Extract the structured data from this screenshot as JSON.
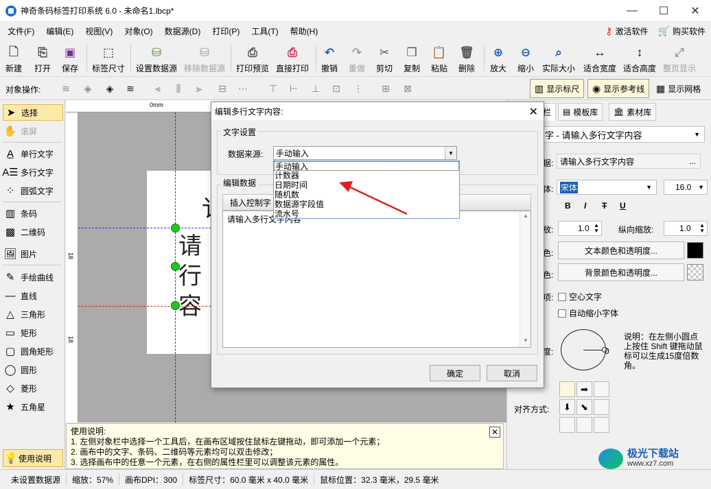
{
  "window": {
    "title": "神奇条码标签打印系统 6.0 - 未命名1.lbcp*",
    "minimize": "—",
    "maximize": "☐",
    "close": "✕"
  },
  "menus": [
    "文件(F)",
    "编辑(E)",
    "视图(V)",
    "对象(O)",
    "数据源(D)",
    "打印(P)",
    "工具(T)",
    "帮助(H)"
  ],
  "menu_right": {
    "activate": "激活软件",
    "buy": "购买软件"
  },
  "toolbar": {
    "new": "新建",
    "open": "打开",
    "save": "保存",
    "label_size": "标签尺寸",
    "set_datasource": "设置数据源",
    "remove_datasource": "移除数据源",
    "print_preview": "打印预览",
    "direct_print": "直接打印",
    "undo": "撤销",
    "redo": "重做",
    "cut": "剪切",
    "copy": "复制",
    "paste": "粘贴",
    "delete": "删除",
    "zoom_in": "放大",
    "zoom_out": "缩小",
    "actual_size": "实际大小",
    "fit_width": "适合宽度",
    "fit_height": "适合高度",
    "full_page": "整页显示"
  },
  "objbar": {
    "label": "对象操作:",
    "show_ruler": "显示标尺",
    "show_guides": "显示参考线",
    "show_grid": "显示网格"
  },
  "tools": {
    "select": "选择",
    "scroll": "滚屏",
    "single_text": "单行文字",
    "multi_text": "多行文字",
    "arc_text": "圆弧文字",
    "barcode": "条码",
    "qrcode": "二维码",
    "image": "图片",
    "freehand": "手绘曲线",
    "line": "直线",
    "triangle": "三角形",
    "rect": "矩形",
    "round_rect": "圆角矩形",
    "circle": "圆形",
    "diamond": "菱形",
    "star": "五角星",
    "usage": "使用说明"
  },
  "canvas": {
    "ruler_zero": "0mm",
    "ruler_mark_1": "18",
    "ruler_mark_2": "18",
    "label_chars": [
      "请",
      "行",
      "容"
    ],
    "partial_top": "讠"
  },
  "help": {
    "title": "使用说明:",
    "lines": [
      "1. 左侧对象栏中选择一个工具后，在画布区域按住鼠标左键拖动，即可添加一个元素；",
      "2. 画布中的文字、条码、二维码等元素均可以双击修改；",
      "3. 选择画布中的任意一个元素，在右侧的属性栏里可以调整该元素的属性。"
    ],
    "close": "✕"
  },
  "right_panel": {
    "tab_partial": "栏",
    "tab_templates": "模板库",
    "tab_materials": "素材库",
    "object_select": "字 - 请输入多行文字内容",
    "content_label": "据:",
    "content_value": "请输入多行文字内容",
    "content_btn": "...",
    "font_label": "体:",
    "font_value": "宋体",
    "font_size": "16.0",
    "style_b": "B",
    "style_i": "I",
    "style_s": "T",
    "style_u": "U",
    "hscale_label": "放:",
    "hscale_value": "1.0",
    "vscale_label": "纵向缩放:",
    "vscale_value": "1.0",
    "text_color_label": "色:",
    "text_color_btn": "文本颜色和透明度...",
    "bg_color_label": "色:",
    "bg_color_btn": "背景颜色和透明度...",
    "effect_label": "项:",
    "hollow": "空心文字",
    "autoshrink": "自动缩小字体",
    "rotate_label": "度:",
    "rotate_value": "0",
    "rotate_help": "说明：在左侧小圆点上按住 Shift 键拖动鼠标可以生成15度倍数角。",
    "align_label": "对齐方式:"
  },
  "status": {
    "datasource": "未设置数据源",
    "zoom": "缩放：57%",
    "dpi": "画布DPI：300",
    "label_size": "标签尺寸：60.0 毫米 x 40.0 毫米",
    "mouse_pos": "鼠标位置：32.3 毫米，29.5 毫米"
  },
  "dialog": {
    "title": "编辑多行文字内容:",
    "close": "✕",
    "group_text_settings": "文字设置",
    "source_label": "数据来源:",
    "source_value": "手动输入",
    "source_options": [
      "手动输入",
      "计数器",
      "日期时间",
      "随机数",
      "数据源字段值",
      "流水号"
    ],
    "group_edit_data": "编辑数据",
    "insert_ctrl": "插入控制字",
    "text_content": "请输入多行文字内容",
    "ok": "确定",
    "cancel": "取消"
  },
  "watermark": {
    "brand": "极光下载站",
    "url": "www.xz7.com"
  },
  "colors": {
    "accent": "#1a6fd1",
    "selection": "#fde9a9",
    "handle": "#22c622",
    "arrow": "#e02020"
  }
}
